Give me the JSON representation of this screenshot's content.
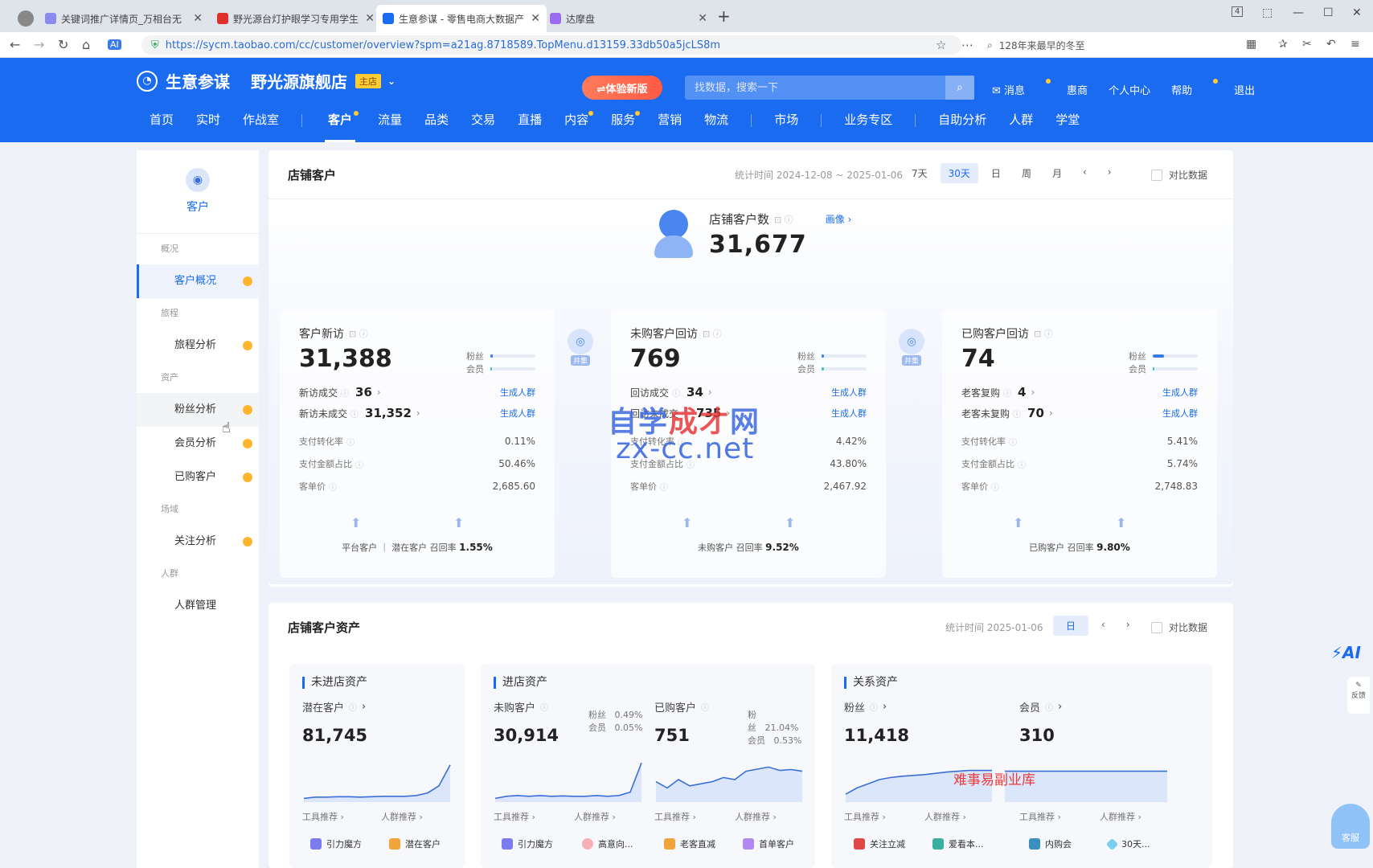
{
  "browser": {
    "tabs": [
      {
        "label": "关键词推广详情页_万相台无",
        "color": "#8a8af0"
      },
      {
        "label": "野光源台灯护眼学习专用学生",
        "color": "#e0302a"
      },
      {
        "label": "生意参谋 - 零售电商大数据产",
        "color": "#1a6bf0"
      },
      {
        "label": "达摩盘",
        "color": "#9a6af0"
      }
    ],
    "url": "https://sycm.taobao.com/cc/customer/overview?spm=a21ag.8718589.TopMenu.d13159.33db50a5jcLS8m",
    "search_text": "128年来最早的冬至",
    "window_badge": "4"
  },
  "header": {
    "logo": "生意参谋",
    "shop_name": "野光源旗舰店",
    "shop_badge": "主店",
    "try_new": "⇌体验新版",
    "search_placeholder": "找数据，搜索一下",
    "links": [
      "消息",
      "惠商",
      "个人中心",
      "帮助",
      "退出"
    ],
    "nav": [
      "首页",
      "实时",
      "作战室",
      "客户",
      "流量",
      "品类",
      "交易",
      "直播",
      "内容",
      "服务",
      "营销",
      "物流",
      "市场",
      "业务专区",
      "自助分析",
      "人群",
      "学堂"
    ]
  },
  "sidebar": {
    "title": "客户",
    "groups": [
      {
        "label": "概况",
        "items": [
          "客户概况"
        ]
      },
      {
        "label": "旅程",
        "items": [
          "旅程分析"
        ]
      },
      {
        "label": "资产",
        "items": [
          "粉丝分析",
          "会员分析",
          "已购客户"
        ]
      },
      {
        "label": "场域",
        "items": [
          "关注分析"
        ]
      },
      {
        "label": "人群",
        "items": [
          "人群管理"
        ]
      }
    ]
  },
  "panel1": {
    "title": "店铺客户",
    "stat_time": "统计时间 2024-12-08 ~ 2025-01-06",
    "periods": [
      "7天",
      "30天",
      "日",
      "周",
      "月"
    ],
    "compare": "对比数据",
    "hero_label": "店铺客户数",
    "hero_link": "画像 ›",
    "hero_value": "31,677",
    "fans_label": "粉丝",
    "member_label": "会员",
    "gen_label": "生成人群",
    "connector_tag": "并集",
    "metric_labels": [
      "支付转化率",
      "支付金额占比",
      "客单价"
    ],
    "cards": [
      {
        "title": "客户新访",
        "value": "31,388",
        "fans_pct": 0.05,
        "member_pct": 0.04,
        "row1_label": "新访成交",
        "row1_value": "36",
        "row2_label": "新访未成交",
        "row2_value": "31,352",
        "metrics": [
          "0.11%",
          "50.46%",
          "2,685.60"
        ],
        "foot_label": "平台客户 ｜ 潜在客户  召回率",
        "foot_value": "1.55%"
      },
      {
        "title": "未购客户回访",
        "value": "769",
        "fans_pct": 0.06,
        "member_pct": 0.05,
        "row1_label": "回访成交",
        "row1_value": "34",
        "row2_label": "回访未成交",
        "row2_value": "735",
        "metrics": [
          "4.42%",
          "43.80%",
          "2,467.92"
        ],
        "foot_label": "未购客户  召回率",
        "foot_value": "9.52%"
      },
      {
        "title": "已购客户回访",
        "value": "74",
        "fans_pct": 0.25,
        "member_pct": 0.04,
        "row1_label": "老客复购",
        "row1_value": "4",
        "row2_label": "老客未复购",
        "row2_value": "70",
        "metrics": [
          "5.41%",
          "5.74%",
          "2,748.83"
        ],
        "foot_label": "已购客户  召回率",
        "foot_value": "9.80%"
      }
    ]
  },
  "panel2": {
    "title": "店铺客户资产",
    "stat_time": "统计时间 2025-01-06",
    "period": "日",
    "compare": "对比数据",
    "tool_rec": "工具推荐 ›",
    "crowd_rec": "人群推荐 ›",
    "sections": [
      {
        "title": "未进店资产"
      },
      {
        "title": "进店资产"
      },
      {
        "title": "关系资产"
      }
    ],
    "subs": [
      {
        "label": "潜在客户",
        "value": "81,745",
        "chips": [
          "引力魔方",
          "潜在客户"
        ],
        "spark": [
          0.05,
          0.08,
          0.08,
          0.09,
          0.09,
          0.08,
          0.09,
          0.1,
          0.1,
          0.1,
          0.12,
          0.18,
          0.35,
          0.85
        ]
      },
      {
        "label": "未购客户",
        "value": "30,914",
        "fans": "0.49%",
        "member": "0.05%",
        "chips": [
          "引力魔方",
          "高意向..."
        ],
        "spark": [
          0.05,
          0.1,
          0.12,
          0.1,
          0.12,
          0.1,
          0.11,
          0.1,
          0.1,
          0.12,
          0.1,
          0.12,
          0.2,
          0.9
        ]
      },
      {
        "label": "已购客户",
        "value": "751",
        "fans": "21.04%",
        "member": "0.53%",
        "chips": [
          "老客直减",
          "首单客户"
        ],
        "spark": [
          0.45,
          0.3,
          0.5,
          0.35,
          0.4,
          0.45,
          0.55,
          0.5,
          0.7,
          0.75,
          0.8,
          0.72,
          0.74,
          0.7
        ]
      },
      {
        "label": "粉丝",
        "value": "11,418",
        "chips": [
          "关注立减",
          "爱看本..."
        ],
        "spark": [
          0.15,
          0.3,
          0.4,
          0.5,
          0.55,
          0.58,
          0.6,
          0.62,
          0.65,
          0.68,
          0.7,
          0.72,
          0.72,
          0.72
        ]
      },
      {
        "label": "会员",
        "value": "310",
        "chips": [
          "内购会",
          "30天..."
        ],
        "spark": [
          0.7,
          0.7,
          0.7,
          0.7,
          0.7,
          0.7,
          0.7,
          0.7,
          0.7,
          0.7,
          0.7,
          0.7,
          0.7,
          0.7
        ]
      }
    ]
  },
  "watermarks": {
    "line1a": "自学",
    "line1b": "成才",
    "line1c": "网",
    "line2": "zx-cc.net",
    "line3": "难事易副业库"
  },
  "float": {
    "ai": "AI",
    "feedback": "反馈",
    "service": "客服"
  }
}
